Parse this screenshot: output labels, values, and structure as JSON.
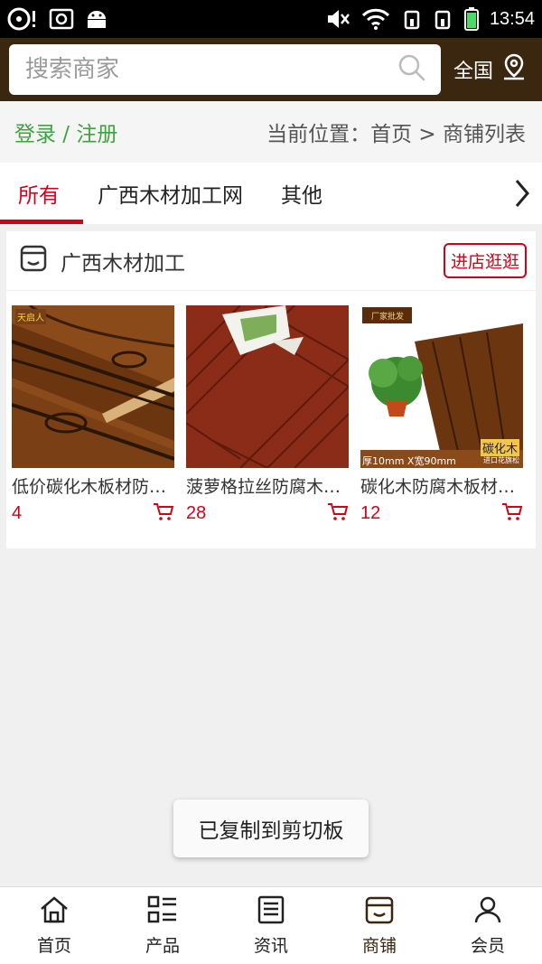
{
  "status_bar": {
    "time": "13:54"
  },
  "search": {
    "placeholder": "搜索商家"
  },
  "region": {
    "label": "全国"
  },
  "breadcrumb": {
    "login": "登录 / 注册",
    "location": "当前位置：首页 > 商铺列表"
  },
  "tabs": [
    {
      "label": "所有",
      "active": true
    },
    {
      "label": "广西木材加工网",
      "active": false
    },
    {
      "label": "其他",
      "active": false
    }
  ],
  "store": {
    "name": "广西木材加工",
    "visit_label": "进店逛逛",
    "products": [
      {
        "name": "低价碳化木板材防腐木",
        "count": "4",
        "image_badge": "天启人"
      },
      {
        "name": "菠萝格拉丝防腐木地板",
        "count": "28"
      },
      {
        "name": "碳化木防腐木板材地板",
        "count": "12",
        "image_badges": {
          "top": "厂家批发",
          "bottom_right": "碳化木",
          "bottom_right_sub": "进口花旗松",
          "spec": "厚10mm X宽90mm"
        }
      }
    ]
  },
  "toast": {
    "message": "已复制到剪切板"
  },
  "bottom_nav": [
    {
      "label": "首页",
      "icon": "home-icon"
    },
    {
      "label": "产品",
      "icon": "list-icon"
    },
    {
      "label": "资讯",
      "icon": "news-icon"
    },
    {
      "label": "商铺",
      "icon": "store-icon",
      "active": true
    },
    {
      "label": "会员",
      "icon": "user-icon"
    }
  ],
  "colors": {
    "header_bg": "#3b2610",
    "accent_red": "#d0021b",
    "login_green": "#3fa33f"
  }
}
